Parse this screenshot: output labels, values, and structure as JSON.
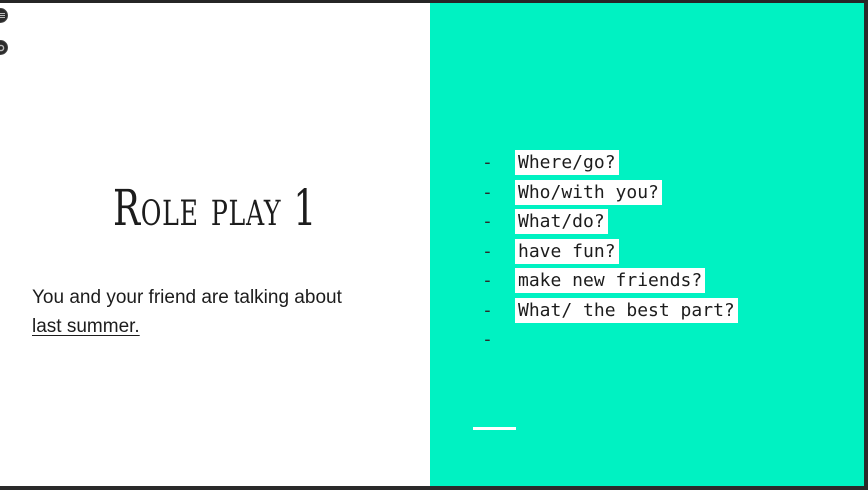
{
  "slide": {
    "title": "Role play 1",
    "body_text": "You and your friend are talking about",
    "body_link": "last summer.",
    "bullets": [
      "Where/go?",
      "Who/with you?",
      "What/do?",
      "have fun?",
      "make new friends?",
      "What/ the best part?",
      ""
    ]
  },
  "controls": {
    "top_icon": "menu-icon",
    "second_icon": "settings-icon"
  },
  "colors": {
    "accent_panel": "#00f2c2",
    "text": "#1c1c1c",
    "highlight": "#ffffff"
  }
}
